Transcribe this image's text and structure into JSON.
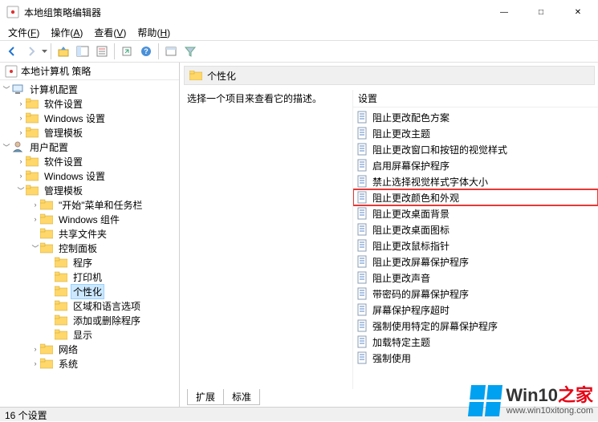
{
  "title": "本地组策略编辑器",
  "window_controls": {
    "min": "—",
    "max": "□",
    "close": "✕"
  },
  "menu": [
    {
      "label": "文件",
      "ul": "F"
    },
    {
      "label": "操作",
      "ul": "A"
    },
    {
      "label": "查看",
      "ul": "V"
    },
    {
      "label": "帮助",
      "ul": "H"
    }
  ],
  "tree": {
    "root": "本地计算机 策略",
    "computer": {
      "label": "计算机配置",
      "children": [
        "软件设置",
        "Windows 设置",
        "管理模板"
      ]
    },
    "user": {
      "label": "用户配置",
      "children": {
        "software": "软件设置",
        "windows": "Windows 设置",
        "admin": {
          "label": "管理模板",
          "children": {
            "start": "\"开始\"菜单和任务栏",
            "wincomp": "Windows 组件",
            "shared": "共享文件夹",
            "ctrl": {
              "label": "控制面板",
              "children": [
                "程序",
                "打印机",
                "个性化",
                "区域和语言选项",
                "添加或删除程序",
                "显示"
              ],
              "selected_index": 2
            },
            "network": "网络",
            "system": "系统"
          }
        }
      }
    }
  },
  "right": {
    "header": "个性化",
    "description": "选择一个项目来查看它的描述。",
    "column_header": "设置",
    "items": [
      "阻止更改配色方案",
      "阻止更改主题",
      "阻止更改窗口和按钮的视觉样式",
      "启用屏幕保护程序",
      "禁止选择视觉样式字体大小",
      "阻止更改颜色和外观",
      "阻止更改桌面背景",
      "阻止更改桌面图标",
      "阻止更改鼠标指针",
      "阻止更改屏幕保护程序",
      "阻止更改声音",
      "带密码的屏幕保护程序",
      "屏幕保护程序超时",
      "强制使用特定的屏幕保护程序",
      "加载特定主题",
      "强制使用"
    ],
    "highlight_index": 5,
    "tabs": [
      "扩展",
      "标准"
    ],
    "active_tab": 0
  },
  "status": "16 个设置",
  "watermark": {
    "brand_a": "Win10",
    "brand_b": "之家",
    "url": "www.win10xitong.com"
  }
}
